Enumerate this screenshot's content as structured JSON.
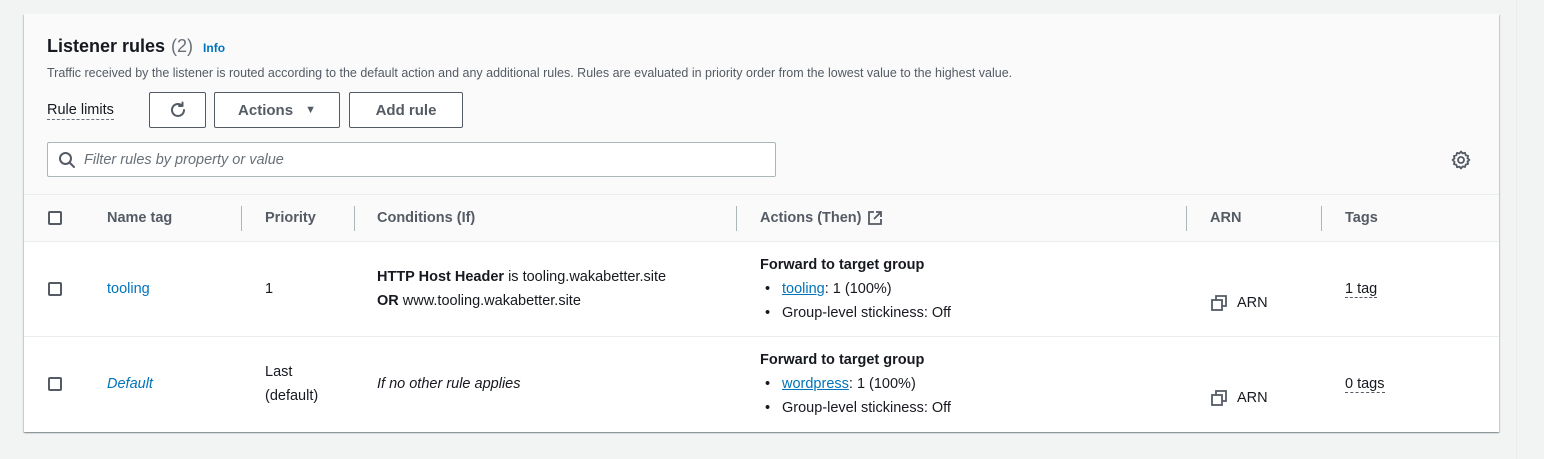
{
  "header": {
    "title": "Listener rules",
    "count": "(2)",
    "info": "Info",
    "description": "Traffic received by the listener is routed according to the default action and any additional rules. Rules are evaluated in priority order from the lowest value to the highest value."
  },
  "toolbar": {
    "rule_limits": "Rule limits",
    "actions_label": "Actions",
    "add_rule_label": "Add rule"
  },
  "search": {
    "placeholder": "Filter rules by property or value"
  },
  "table": {
    "columns": {
      "name_tag": "Name tag",
      "priority": "Priority",
      "conditions": "Conditions (If)",
      "actions": "Actions (Then)",
      "arn": "ARN",
      "tags": "Tags"
    },
    "rows": [
      {
        "name": "tooling",
        "priority": "1",
        "condition_header": "HTTP Host Header",
        "condition_is": " is tooling.wakabetter.site",
        "condition_or": "OR",
        "condition_or_value": " www.tooling.wakabetter.site",
        "action_title": "Forward to target group",
        "target_group": "tooling",
        "target_weight": ": 1 (100%)",
        "stickiness": "Group-level stickiness: Off",
        "arn": "ARN",
        "tags": "1 tag"
      },
      {
        "name": "Default",
        "priority_line1": "Last",
        "priority_line2": "(default)",
        "condition": "If no other rule applies",
        "action_title": "Forward to target group",
        "target_group": "wordpress",
        "target_weight": ": 1 (100%)",
        "stickiness": "Group-level stickiness: Off",
        "arn": "ARN",
        "tags": "0 tags"
      }
    ]
  },
  "colors": {
    "link": "#0073bb",
    "text": "#16191f",
    "secondary": "#545b64",
    "header_bg": "#fafafa"
  }
}
